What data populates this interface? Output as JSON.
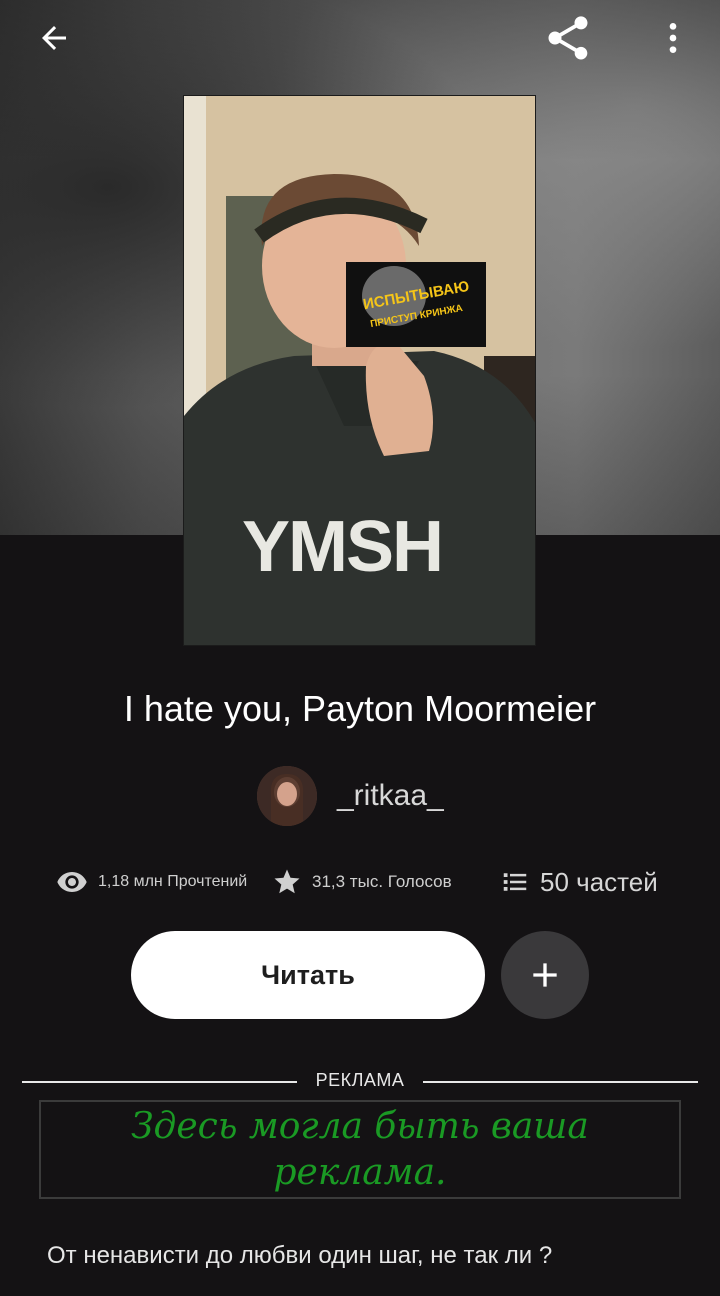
{
  "story": {
    "title": "I hate you, Payton Moormeier",
    "author": "_ritkaa_",
    "cover_sticker": {
      "line1": "ИСПЫТЫВАЮ",
      "line2": "ПРИСТУП КРИНЖА"
    },
    "cover_shirt_text": "YMSH",
    "description": "От ненависти до любви один шаг, не так ли ?"
  },
  "stats": {
    "reads": "1,18 млн Прочтений",
    "votes": "31,3 тыс. Голосов",
    "parts": "50 частей"
  },
  "actions": {
    "read_label": "Читать"
  },
  "ad": {
    "label": "РЕКЛАМА",
    "placeholder_line1": "Здесь могла быть ваша",
    "placeholder_line2": "реклама."
  },
  "icons": {
    "back": "back-arrow-icon",
    "share": "share-icon",
    "more": "more-vertical-icon",
    "reads": "eye-icon",
    "votes": "star-icon",
    "parts": "list-icon",
    "add": "plus-icon"
  },
  "colors": {
    "background": "#141214",
    "read_button": "#ffffff",
    "add_button": "#3a393b",
    "ad_text": "#1a9a24",
    "sticker_text": "#f5c518"
  }
}
